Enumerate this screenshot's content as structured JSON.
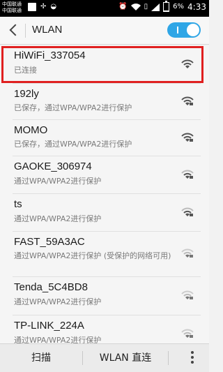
{
  "status_bar": {
    "carrier_top": "中国联通",
    "carrier_bottom": "中国联通",
    "battery_percent": "6%",
    "time": "4:33"
  },
  "header": {
    "title": "WLAN",
    "toggle_on": true
  },
  "networks": [
    {
      "name": "HiWiFi_337054",
      "status": "已连接",
      "secured": false,
      "selected": true
    },
    {
      "name": "192ly",
      "status": "已保存，通过WPA/WPA2进行保护",
      "secured": true
    },
    {
      "name": "MOMO",
      "status": "已保存，通过WPA/WPA2进行保护",
      "secured": true
    },
    {
      "name": "GAOKE_306974",
      "status": "通过WPA/WPA2进行保护",
      "secured": true
    },
    {
      "name": "ts",
      "status": "通过WPA/WPA2进行保护",
      "secured": true
    },
    {
      "name": "FAST_59A3AC",
      "status": "通过WPA/WPA2进行保护 (受保护的网络可用)",
      "secured": true
    },
    {
      "name": "Tenda_5C4BD8",
      "status": "通过WPA/WPA2进行保护",
      "secured": true
    },
    {
      "name": "TP-LINK_224A",
      "status": "通过WPA/WPA2进行保护",
      "secured": true
    }
  ],
  "bottom_bar": {
    "scan_label": "扫描",
    "direct_label": "WLAN 直连"
  },
  "colors": {
    "accent": "#2fa6e6",
    "highlight": "#e02020"
  }
}
